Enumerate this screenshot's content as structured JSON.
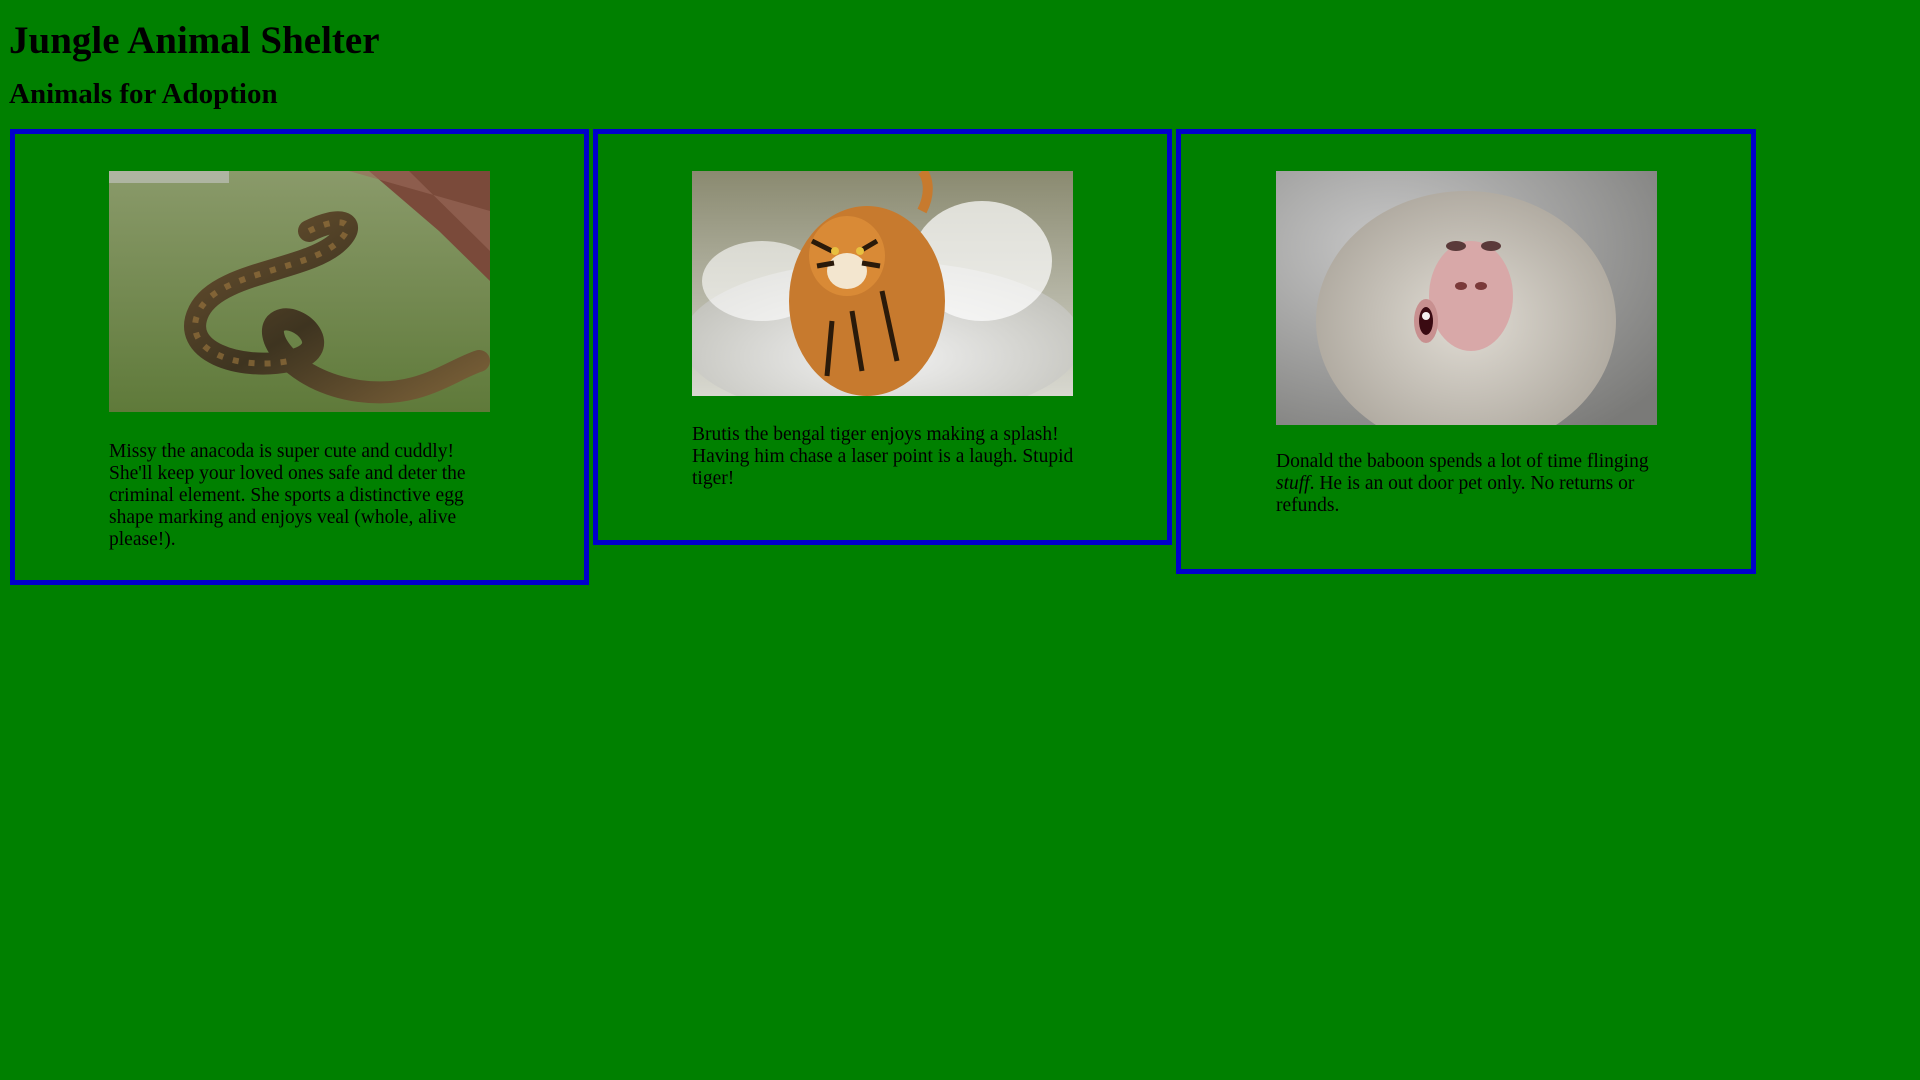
{
  "header": {
    "title": "Jungle Animal Shelter",
    "subtitle": "Animals for Adoption"
  },
  "colors": {
    "background": "#008000",
    "card_border": "#0000cc"
  },
  "animals": [
    {
      "photo_icon": "anaconda-photo",
      "text": "Missy the anacoda is super cute and cuddly! She'll keep your loved ones safe and deter the criminal element. She sports a distinctive egg shape marking and enjoys veal (whole, alive please!)."
    },
    {
      "photo_icon": "tiger-photo",
      "text": "Brutis the bengal tiger enjoys making a splash! Having him chase a laser point is a laugh. Stupid tiger!"
    },
    {
      "photo_icon": "baboon-photo",
      "text_before": "Donald the baboon spends a lot of time flinging ",
      "text_emphasis": "stuff",
      "text_after": ". He is an out door pet only. No returns or refunds."
    }
  ]
}
